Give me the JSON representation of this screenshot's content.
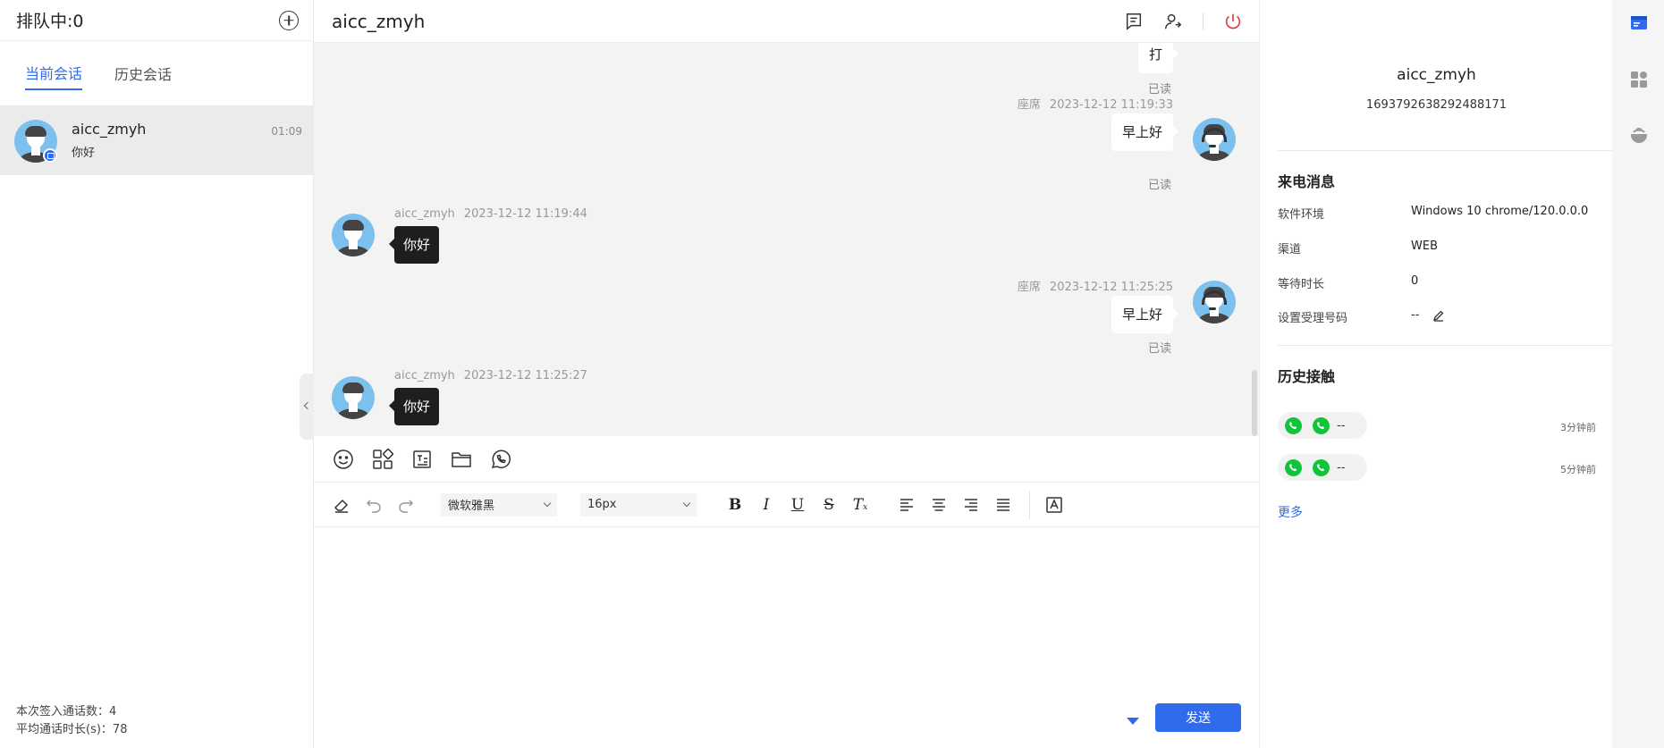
{
  "left": {
    "queue_title": "排队中:0",
    "tabs": [
      {
        "label": "当前会话",
        "active": true
      },
      {
        "label": "历史会话",
        "active": false
      }
    ],
    "session": {
      "name": "aicc_zmyh",
      "last_message": "你好",
      "time": "01:09"
    },
    "stats": {
      "calls_line": "本次签入通话数：4",
      "avg_line": "平均通话时长(s)：78"
    }
  },
  "chat": {
    "title": "aicc_zmyh",
    "messages": [
      {
        "side": "right",
        "text": "打",
        "read": "已读"
      },
      {
        "side": "right",
        "sender": "座席",
        "time": "2023-12-12 11:19:33",
        "text": "早上好",
        "read": "已读"
      },
      {
        "side": "left",
        "sender": "aicc_zmyh",
        "time": "2023-12-12 11:19:44",
        "text": "你好"
      },
      {
        "side": "right",
        "sender": "座席",
        "time": "2023-12-12 11:25:25",
        "text": "早上好",
        "read": "已读"
      },
      {
        "side": "left",
        "sender": "aicc_zmyh",
        "time": "2023-12-12 11:25:27",
        "text": "你好"
      }
    ],
    "toolbar": {
      "font_family": "微软雅黑",
      "font_size": "16px"
    },
    "send_label": "发送"
  },
  "info": {
    "name": "aicc_zmyh",
    "id": "1693792638292488171",
    "section_incoming": "来电消息",
    "fields": [
      {
        "label": "软件环境",
        "value": "Windows 10 chrome/120.0.0.0"
      },
      {
        "label": "渠道",
        "value": "WEB"
      },
      {
        "label": "等待时长",
        "value": "0"
      },
      {
        "label": "设置受理号码",
        "value": "--"
      }
    ],
    "section_history": "历史接触",
    "history": [
      {
        "text": "--",
        "ago": "3分钟前"
      },
      {
        "text": "--",
        "ago": "5分钟前"
      }
    ],
    "more_label": "更多"
  },
  "colors": {
    "accent": "#2f6bec",
    "phone_green": "#11c43a",
    "danger": "#e23b3b"
  }
}
